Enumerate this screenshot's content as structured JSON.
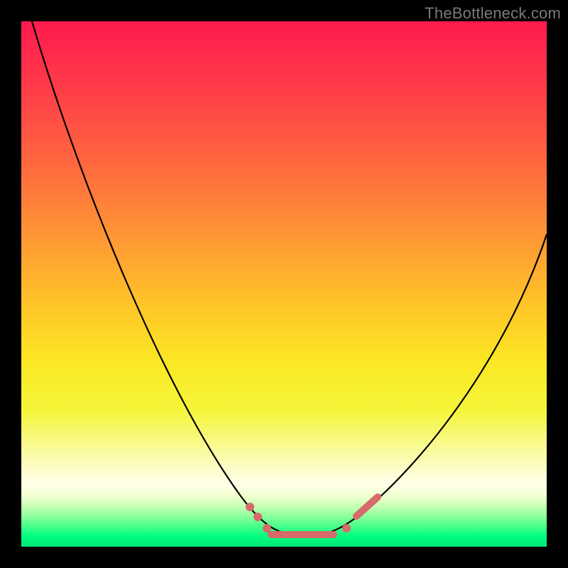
{
  "watermark": "TheBottleneck.com",
  "chart_data": {
    "type": "line",
    "title": "",
    "xlabel": "",
    "ylabel": "",
    "xlim": [
      0,
      100
    ],
    "ylim": [
      0,
      100
    ],
    "grid": false,
    "legend": false,
    "note": "Axes unlabeled in image; values are relative pixel-estimates of the V-shaped bottleneck curve. 0 at bottom/left, 100 at top/right.",
    "series": [
      {
        "name": "bottleneck-curve",
        "x": [
          2,
          6,
          10,
          14,
          18,
          22,
          26,
          30,
          34,
          38,
          42,
          46,
          48,
          50,
          52,
          54,
          56,
          58,
          60,
          62,
          66,
          70,
          74,
          78,
          82,
          86,
          90,
          94,
          98,
          100
        ],
        "y": [
          100,
          92,
          84,
          76,
          68,
          60,
          52,
          44,
          36,
          28,
          20,
          12,
          8,
          5,
          3,
          2,
          2,
          2,
          3,
          5,
          10,
          17,
          24,
          31,
          38,
          44,
          50,
          55,
          59,
          61
        ]
      }
    ],
    "markers": {
      "name": "highlight-dots",
      "color": "#d76a6a",
      "points_x": [
        44,
        46,
        48,
        50,
        52,
        54,
        56,
        58,
        60,
        62,
        64,
        66
      ],
      "points_y": [
        12,
        8,
        5,
        3,
        2,
        2,
        2,
        2,
        3,
        5,
        8,
        12
      ]
    }
  }
}
